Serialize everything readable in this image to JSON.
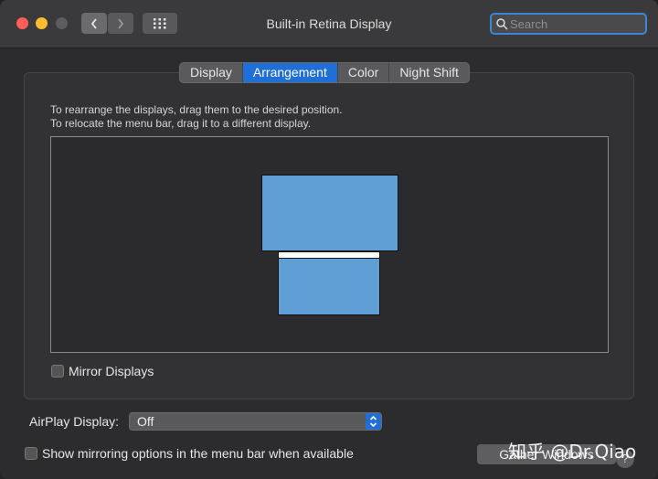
{
  "window": {
    "title": "Built-in Retina Display",
    "search": {
      "placeholder": "Search"
    }
  },
  "tabs": [
    {
      "label": "Display",
      "active": false
    },
    {
      "label": "Arrangement",
      "active": true
    },
    {
      "label": "Color",
      "active": false
    },
    {
      "label": "Night Shift",
      "active": false
    }
  ],
  "arrangement": {
    "instruction_1": "To rearrange the displays, drag them to the desired position.",
    "instruction_2": "To relocate the menu bar, drag it to a different display.",
    "mirror_label": "Mirror Displays",
    "mirror_checked": false
  },
  "airplay": {
    "label": "AirPlay Display:",
    "value": "Off"
  },
  "footer": {
    "show_mirroring_label": "Show mirroring options in the menu bar when available",
    "show_mirroring_checked": false,
    "gather_label": "Gather Windows",
    "help_label": "?"
  },
  "watermark": "知乎 @Dr.Qiao",
  "colors": {
    "accent": "#1f6fd6",
    "display_fill": "#5f9fd6",
    "close": "#ff5f57",
    "minimize": "#febc2e"
  }
}
